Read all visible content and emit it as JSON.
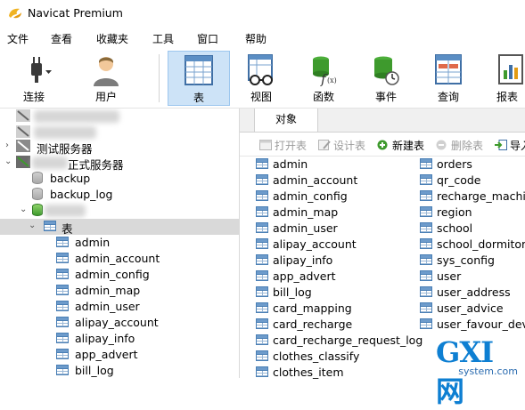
{
  "app": {
    "title": "Navicat Premium"
  },
  "menu": [
    "文件",
    "查看",
    "收藏夹",
    "工具",
    "窗口",
    "帮助"
  ],
  "toolbar": {
    "connect": "连接",
    "user": "用户",
    "table": "表",
    "view": "视图",
    "function": "函数",
    "event": "事件",
    "query": "查询",
    "report": "报表"
  },
  "tree": {
    "server_test": "测试服务器",
    "server_prod_suffix": "正式服务器",
    "databases": [
      "backup",
      "backup_log"
    ],
    "tables_node": "表",
    "tables": [
      "admin",
      "admin_account",
      "admin_config",
      "admin_map",
      "admin_user",
      "alipay_account",
      "alipay_info",
      "app_advert",
      "bill_log"
    ]
  },
  "right": {
    "tab": "对象",
    "obj_toolbar": {
      "open": "打开表",
      "design": "设计表",
      "new": "新建表",
      "delete": "删除表",
      "import": "导入"
    },
    "col1": [
      "admin",
      "admin_account",
      "admin_config",
      "admin_map",
      "admin_user",
      "alipay_account",
      "alipay_info",
      "app_advert",
      "bill_log",
      "card_mapping",
      "card_recharge",
      "card_recharge_request_log",
      "clothes_classify",
      "clothes_item"
    ],
    "col2": [
      "orders",
      "qr_code",
      "recharge_machine",
      "region",
      "school",
      "school_dormitory",
      "sys_config",
      "user",
      "user_address",
      "user_advice",
      "user_favour_device"
    ]
  },
  "watermark": {
    "logo": "GXI网",
    "sub": "system.com"
  },
  "colors": {
    "selected_toolbar": "#cde3f7",
    "tree_selected": "#d9d9d9",
    "table_icon": "#4a7fb5",
    "db_active": "#3d9a2c"
  }
}
